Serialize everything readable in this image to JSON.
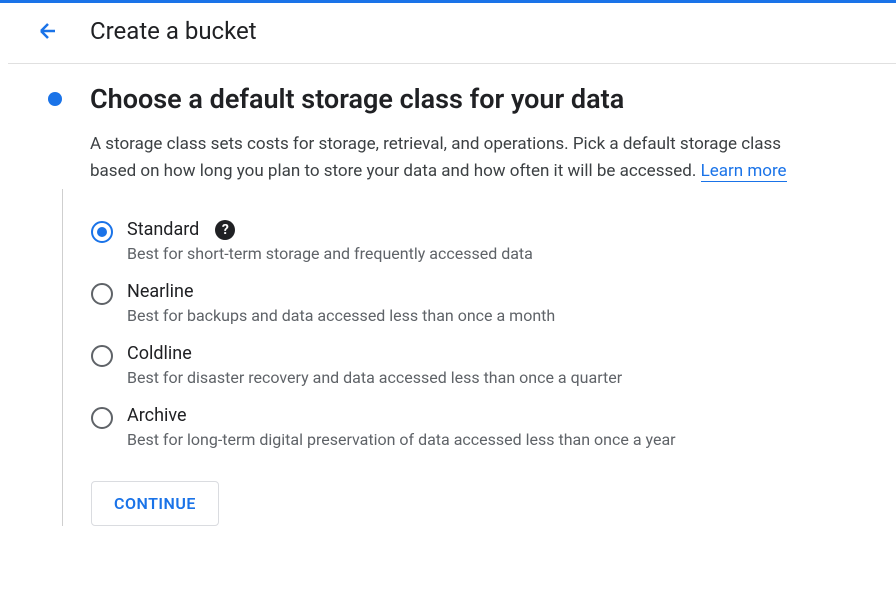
{
  "header": {
    "title": "Create a bucket"
  },
  "section": {
    "title": "Choose a default storage class for your data",
    "description": "A storage class sets costs for storage, retrieval, and operations. Pick a default storage class based on how long you plan to store your data and how often it will be accessed. ",
    "learn_more": "Learn more"
  },
  "options": [
    {
      "label": "Standard",
      "description": "Best for short-term storage and frequently accessed data",
      "selected": true,
      "has_help": true
    },
    {
      "label": "Nearline",
      "description": "Best for backups and data accessed less than once a month",
      "selected": false,
      "has_help": false
    },
    {
      "label": "Coldline",
      "description": "Best for disaster recovery and data accessed less than once a quarter",
      "selected": false,
      "has_help": false
    },
    {
      "label": "Archive",
      "description": "Best for long-term digital preservation of data accessed less than once a year",
      "selected": false,
      "has_help": false
    }
  ],
  "buttons": {
    "continue": "Continue"
  }
}
